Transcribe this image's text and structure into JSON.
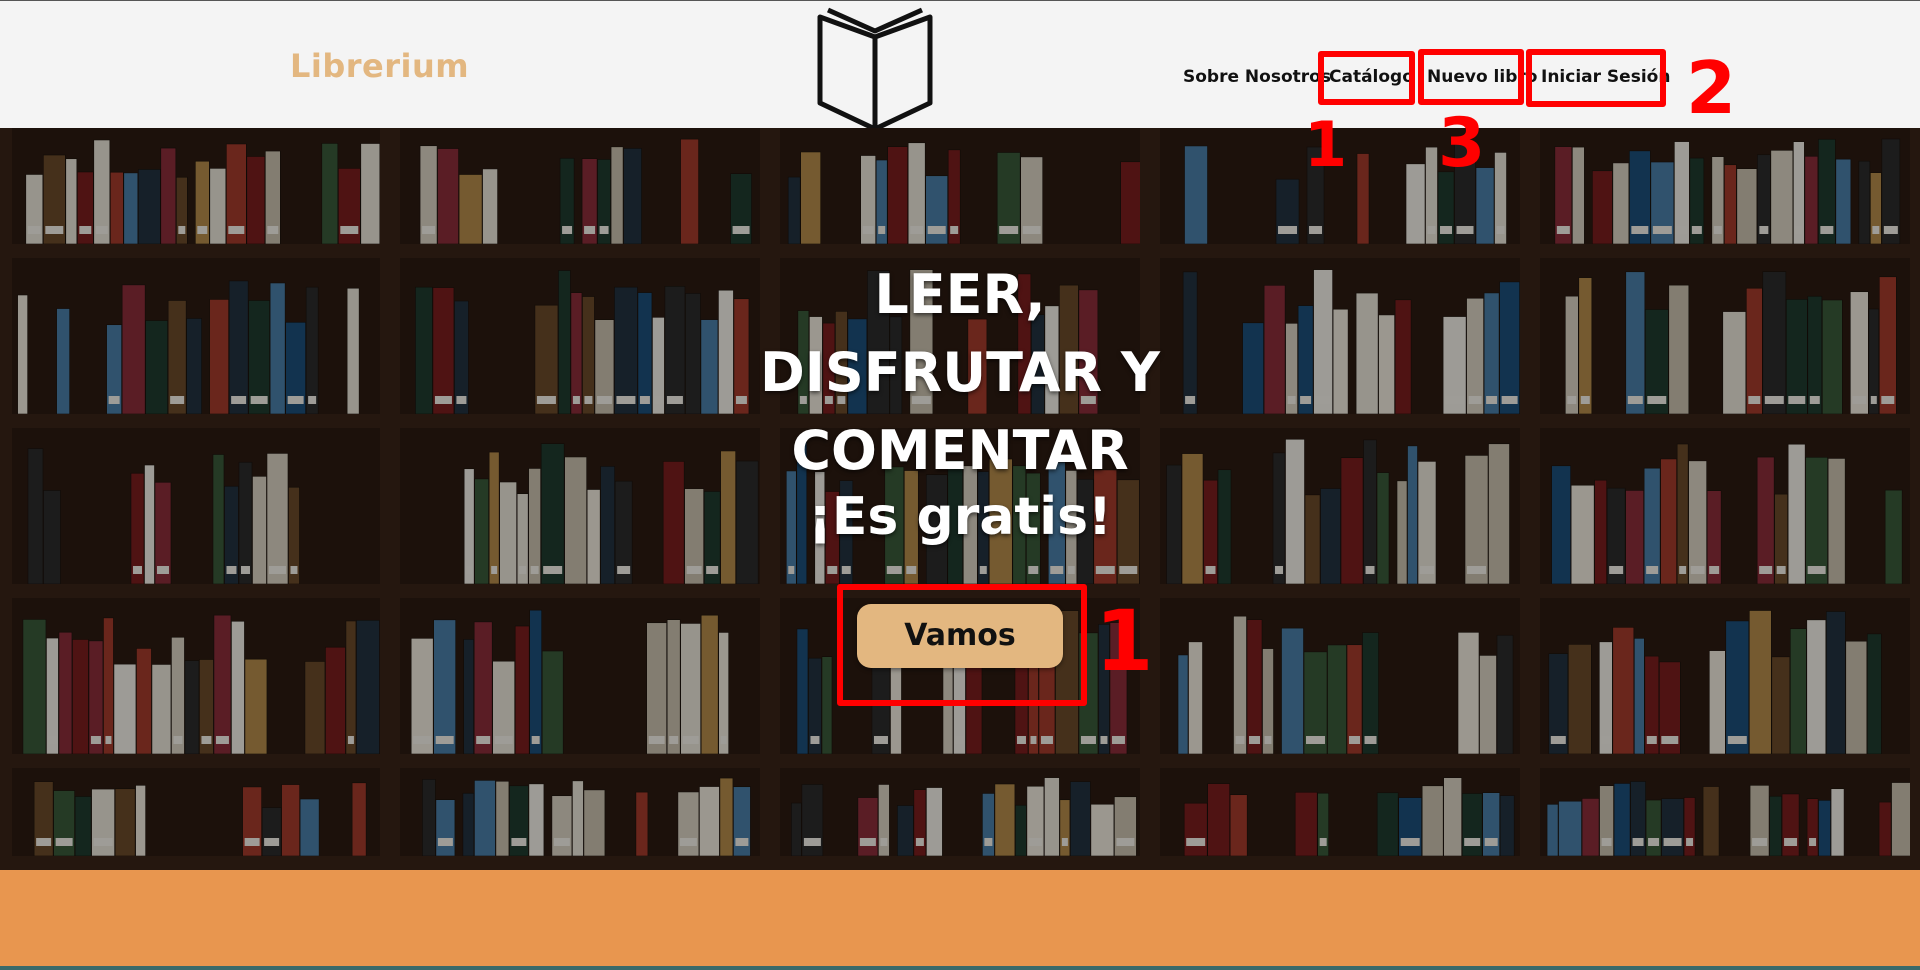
{
  "header": {
    "brand": "Librerium",
    "nav": {
      "about": "Sobre Nosotros",
      "catalog": "Catálogo",
      "new_book": "Nuevo libro",
      "login": "Iniciar Sesión"
    }
  },
  "hero": {
    "headline_lines": [
      "LEER,",
      "DISFRUTAR Y",
      "COMENTAR"
    ],
    "subline": "¡Es gratis!",
    "cta_label": "Vamos"
  },
  "annotations": {
    "catalog_number": "1",
    "new_book_number": "3",
    "login_number": "2",
    "cta_number": "1"
  },
  "colors": {
    "accent": "#e3b780",
    "footer": "#e8964f",
    "annotation": "#ff0000",
    "header_bg": "#f4f4f4"
  },
  "icons": {
    "logo": "open-book-icon"
  }
}
